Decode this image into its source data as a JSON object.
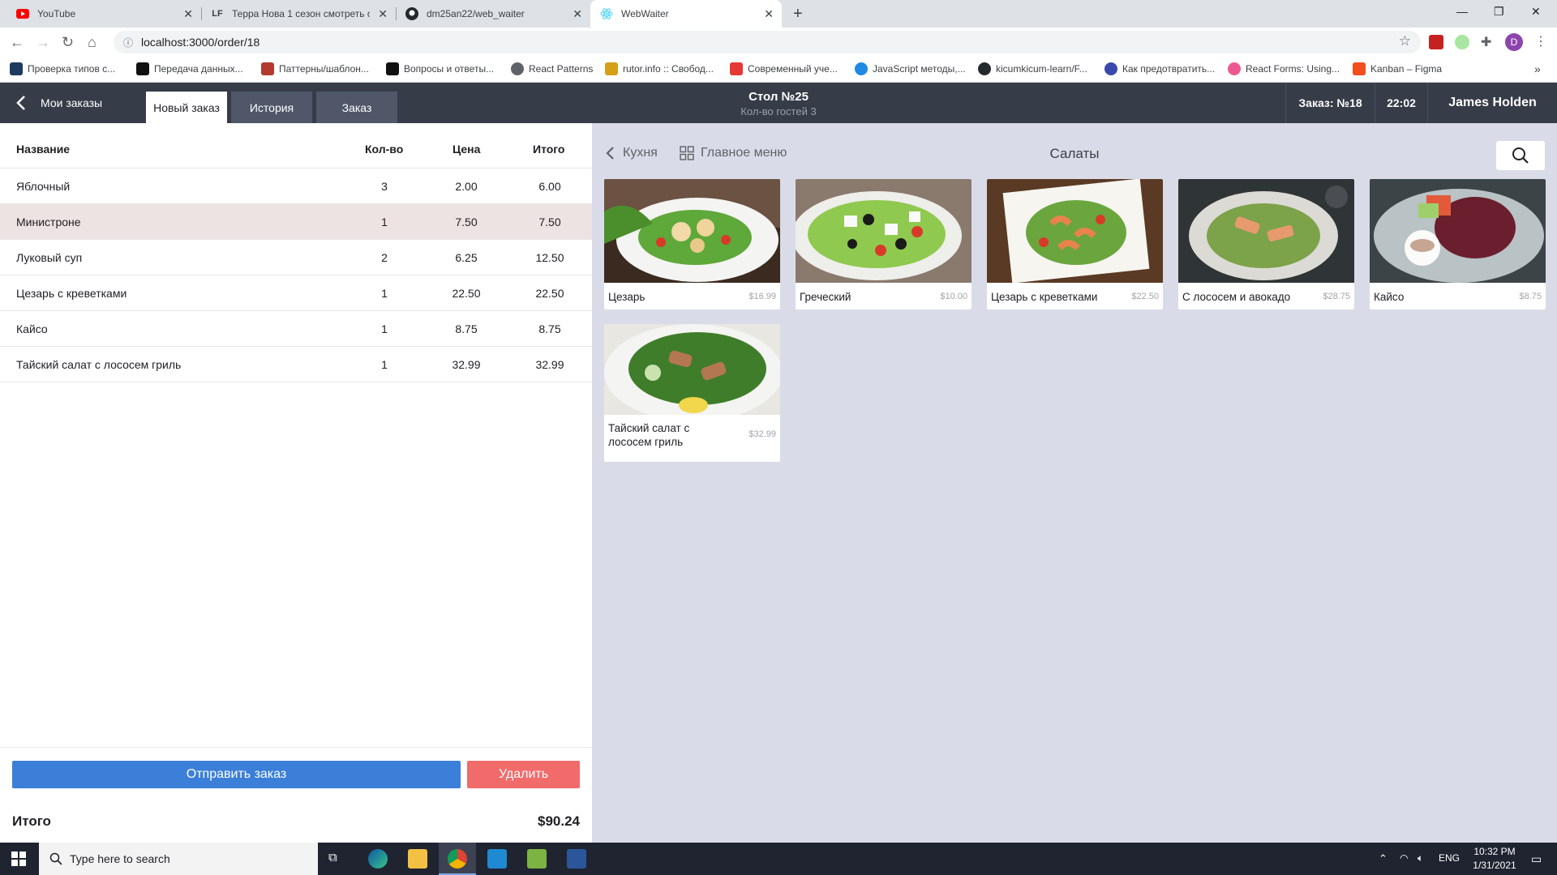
{
  "browser": {
    "tabs": [
      {
        "title": "YouTube",
        "icon": "youtube-icon"
      },
      {
        "title": "Терра Нова 1 сезон смотреть о",
        "icon": "lf-icon",
        "icon_text": "LF"
      },
      {
        "title": "dm25an22/web_waiter",
        "icon": "github-icon"
      },
      {
        "title": "WebWaiter",
        "icon": "react-icon"
      }
    ],
    "url": "localhost:3000/order/18",
    "profile_letter": "D",
    "bookmarks": [
      "Проверка типов с...",
      "Передача данных...",
      "Паттерны/шаблон...",
      "Вопросы и ответы...",
      "React Patterns",
      "rutor.info :: Свобод...",
      "Современный уче...",
      "JavaScript методы,...",
      "kicumkicum-learn/F...",
      "Как предотвратить...",
      "React Forms: Using...",
      "Kanban – Figma"
    ]
  },
  "header": {
    "back_label": "Мои заказы",
    "tabs": [
      "Новый заказ",
      "История",
      "Заказ"
    ],
    "table": "Стол №25",
    "guests": "Кол-во гостей 3",
    "order_no": "Заказ: №18",
    "time": "22:02",
    "waiter": "James Holden"
  },
  "order": {
    "columns": [
      "Название",
      "Кол-во",
      "Цена",
      "Итого"
    ],
    "rows": [
      {
        "name": "Яблочный",
        "qty": "3",
        "price": "2.00",
        "total": "6.00"
      },
      {
        "name": "Министроне",
        "qty": "1",
        "price": "7.50",
        "total": "7.50"
      },
      {
        "name": "Луковый суп",
        "qty": "2",
        "price": "6.25",
        "total": "12.50"
      },
      {
        "name": "Цезарь с креветками",
        "qty": "1",
        "price": "22.50",
        "total": "22.50"
      },
      {
        "name": "Кайсо",
        "qty": "1",
        "price": "8.75",
        "total": "8.75"
      },
      {
        "name": "Тайский салат с лососем гриль",
        "qty": "1",
        "price": "32.99",
        "total": "32.99"
      }
    ],
    "send_label": "Отправить заказ",
    "delete_label": "Удалить",
    "total_label": "Итого",
    "total_value": "$90.24"
  },
  "menu": {
    "back_label": "Кухня",
    "main_menu_label": "Главное меню",
    "category": "Салаты",
    "items": [
      {
        "name": "Цезарь",
        "price": "$16.99"
      },
      {
        "name": "Греческий",
        "price": "$10.00"
      },
      {
        "name": "Цезарь с креветками",
        "price": "$22.50"
      },
      {
        "name": "С лососем и авокадо",
        "price": "$28.75"
      },
      {
        "name": "Кайсо",
        "price": "$8.75"
      },
      {
        "name": "Тайский салат с лососем гриль",
        "price": "$32.99"
      }
    ]
  },
  "taskbar": {
    "search_placeholder": "Type here to search",
    "lang": "ENG",
    "time": "10:32 PM",
    "date": "1/31/2021"
  },
  "colors": {
    "header_bg": "#363c48",
    "send_button": "#3b7fd8",
    "delete_button": "#f26b6b",
    "menu_bg": "#d9dce8",
    "selected_row": "#eee3e3"
  }
}
